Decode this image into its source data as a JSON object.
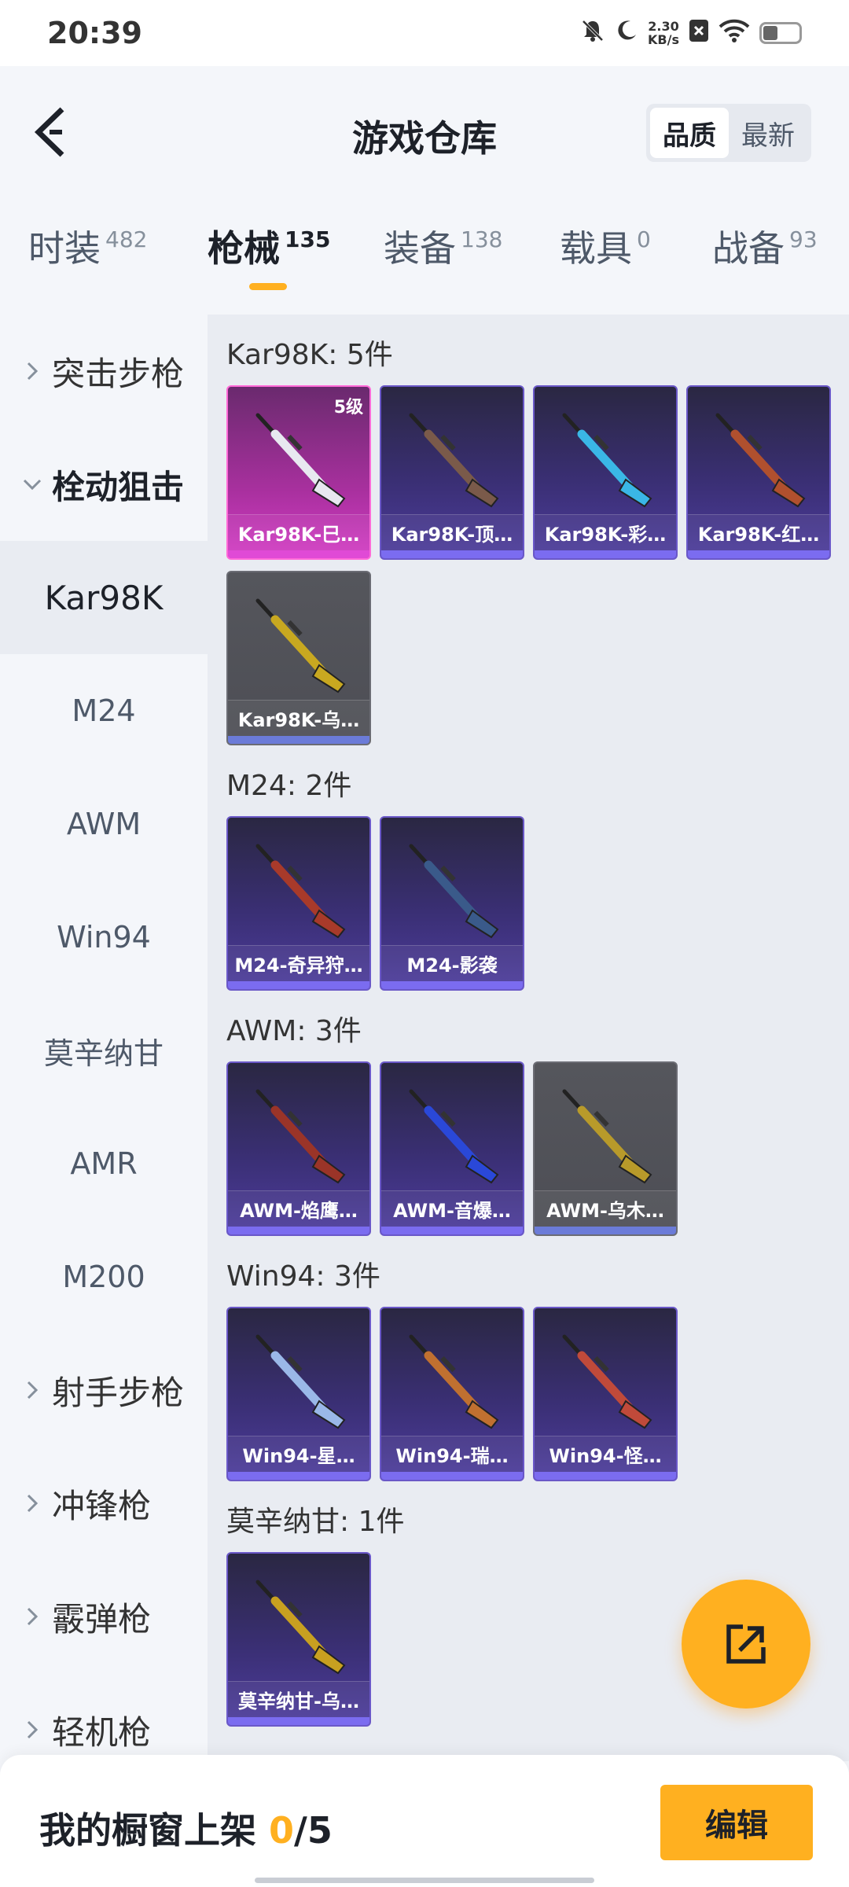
{
  "status_bar": {
    "time": "20:39",
    "net_speed_value": "2.30",
    "net_speed_unit": "KB/s"
  },
  "header": {
    "title": "游戏仓库",
    "sort_options": [
      "品质",
      "最新"
    ],
    "sort_selected": "品质"
  },
  "tabs": [
    {
      "label": "时装",
      "count": "482"
    },
    {
      "label": "枪械",
      "count": "135"
    },
    {
      "label": "装备",
      "count": "138"
    },
    {
      "label": "载具",
      "count": "0"
    },
    {
      "label": "战备",
      "count": "93"
    }
  ],
  "active_tab": "枪械",
  "sidebar": {
    "items": [
      {
        "label": "突击步枪",
        "type": "group",
        "expanded": false
      },
      {
        "label": "栓动狙击",
        "type": "group",
        "expanded": true
      },
      {
        "label": "Kar98K",
        "type": "sub",
        "selected": true
      },
      {
        "label": "M24",
        "type": "sub"
      },
      {
        "label": "AWM",
        "type": "sub"
      },
      {
        "label": "Win94",
        "type": "sub"
      },
      {
        "label": "莫辛纳甘",
        "type": "sub"
      },
      {
        "label": "AMR",
        "type": "sub"
      },
      {
        "label": "M200",
        "type": "sub"
      },
      {
        "label": "射手步枪",
        "type": "group",
        "expanded": false
      },
      {
        "label": "冲锋枪",
        "type": "group",
        "expanded": false
      },
      {
        "label": "霰弹枪",
        "type": "group",
        "expanded": false
      },
      {
        "label": "轻机枪",
        "type": "group",
        "expanded": false
      }
    ]
  },
  "sections": [
    {
      "title": "Kar98K: 5件",
      "items": [
        {
          "name": "Kar98K-巳…",
          "rarity": "pink",
          "level": "5级",
          "gun_color": "#e8e8f0"
        },
        {
          "name": "Kar98K-顶…",
          "rarity": "purple",
          "gun_color": "#7a5a4a"
        },
        {
          "name": "Kar98K-彩…",
          "rarity": "purple",
          "gun_color": "#3ab7e6"
        },
        {
          "name": "Kar98K-红…",
          "rarity": "purple",
          "gun_color": "#b0502e"
        },
        {
          "name": "Kar98K-乌…",
          "rarity": "grey",
          "gun_color": "#c8a820"
        }
      ]
    },
    {
      "title": "M24: 2件",
      "items": [
        {
          "name": "M24-奇异狩…",
          "rarity": "purple",
          "gun_color": "#a83a2a"
        },
        {
          "name": "M24-影袭",
          "rarity": "purple",
          "gun_color": "#3a5a8a"
        }
      ]
    },
    {
      "title": "AWM: 3件",
      "items": [
        {
          "name": "AWM-焰鹰…",
          "rarity": "purple",
          "gun_color": "#9a3428"
        },
        {
          "name": "AWM-音爆…",
          "rarity": "purple",
          "gun_color": "#2a48d8"
        },
        {
          "name": "AWM-乌木…",
          "rarity": "grey",
          "gun_color": "#b89a2a"
        }
      ]
    },
    {
      "title": "Win94: 3件",
      "items": [
        {
          "name": "Win94-星…",
          "rarity": "purple",
          "gun_color": "#9ab8e8"
        },
        {
          "name": "Win94-瑞…",
          "rarity": "purple",
          "gun_color": "#c07030"
        },
        {
          "name": "Win94-怪…",
          "rarity": "purple",
          "gun_color": "#c04a3a"
        }
      ]
    },
    {
      "title": "莫辛纳甘: 1件",
      "items": [
        {
          "name": "莫辛纳甘-乌…",
          "rarity": "purple",
          "gun_color": "#c8a020"
        }
      ]
    }
  ],
  "bottom_bar": {
    "label": "我的橱窗上架 ",
    "current": "0",
    "separator": "/",
    "max": "5",
    "edit_label": "编辑"
  },
  "colors": {
    "accent": "#ffb020",
    "card_purple": "#4d3c9c",
    "card_pink": "#d33cc4",
    "card_grey": "#55565c"
  }
}
